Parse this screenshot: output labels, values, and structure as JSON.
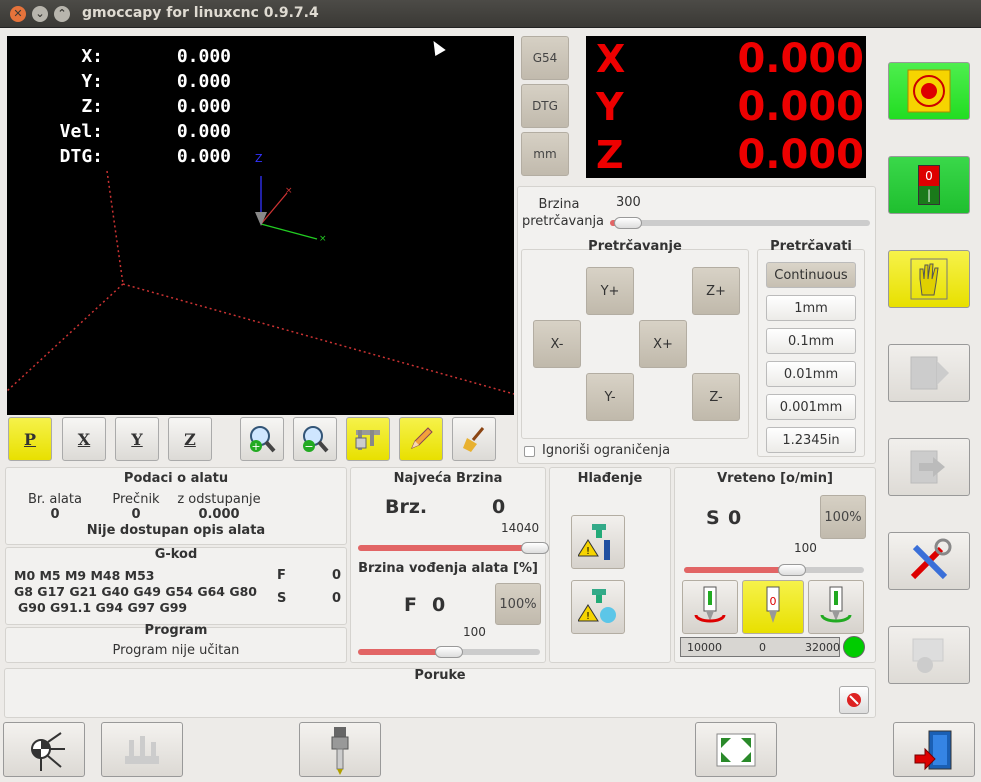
{
  "window": {
    "title": "gmoccapy for linuxcnc 0.9.7.4"
  },
  "preview_dro": [
    {
      "label": "X:",
      "value": "0.000"
    },
    {
      "label": "Y:",
      "value": "0.000"
    },
    {
      "label": "Z:",
      "value": "0.000"
    },
    {
      "label": "Vel:",
      "value": "0.000"
    },
    {
      "label": "DTG:",
      "value": "0.000"
    }
  ],
  "axis_labels": {
    "z": "Z"
  },
  "side_buttons": {
    "coord": "G54",
    "dtg": "DTG",
    "units": "mm"
  },
  "big_dro": [
    {
      "axis": "X",
      "value": "0.000"
    },
    {
      "axis": "Y",
      "value": "0.000"
    },
    {
      "axis": "Z",
      "value": "0.000"
    }
  ],
  "jog": {
    "speed_label_1": "Brzina",
    "speed_label_2": "pretrčavanja",
    "speed_value": "300",
    "title": "Pretrčavanje",
    "buttons": {
      "yplus": "Y+",
      "zplus": "Z+",
      "xminus": "X-",
      "xplus": "X+",
      "yminus": "Y-",
      "zminus": "Z-"
    },
    "ignore_limits": "Ignoriši ograničenja"
  },
  "increments": {
    "title": "Pretrčavati",
    "items": [
      "Continuous",
      "1mm",
      "0.1mm",
      "0.01mm",
      "0.001mm",
      "1.2345in"
    ]
  },
  "tool_info": {
    "title": "Podaci o alatu",
    "col_tool": "Br. alata",
    "col_diameter": "Prečnik",
    "col_offset": "z odstupanje",
    "tool": "0",
    "diameter": "0",
    "offset": "0.000",
    "description": "Nije dostupan opis alata"
  },
  "gcode": {
    "title": "G-kod",
    "line1": "M0 M5 M9 M48 M53",
    "line2": "G8 G17 G21 G40 G49 G54 G64 G80",
    "line3": "G90 G91.1 G94 G97 G99",
    "f_label": "F",
    "f_value": "0",
    "s_label": "S",
    "s_value": "0"
  },
  "program": {
    "title": "Program",
    "status": "Program nije učitan"
  },
  "max_velocity": {
    "title": "Najveća Brzina",
    "label": "Brz.",
    "value": "0",
    "slider_max": "14040",
    "level": 0.97
  },
  "feed": {
    "title": "Brzina vođenja alata [%]",
    "label": "F",
    "value": "0",
    "override_button": "100%",
    "slider_value": "100",
    "level": 0.5
  },
  "coolant": {
    "title": "Hlađenje"
  },
  "spindle": {
    "title": "Vreteno [o/min]",
    "label": "S",
    "value": "0",
    "override_button": "100%",
    "slider_value": "100",
    "level": 0.6,
    "bar_min": "10000",
    "bar_mid": "0",
    "bar_max": "32000",
    "status_color": "#00cc00"
  },
  "messages": {
    "title": "Poruke"
  },
  "estop": {
    "state_on": "0",
    "state_off": "|"
  },
  "colors": {
    "dro_text": "#e00000",
    "estop_bg": "#22dd22",
    "machine_bg": "#1fbf2f",
    "hand_bg": "#f0f000",
    "slider_fill": "#e26565"
  }
}
